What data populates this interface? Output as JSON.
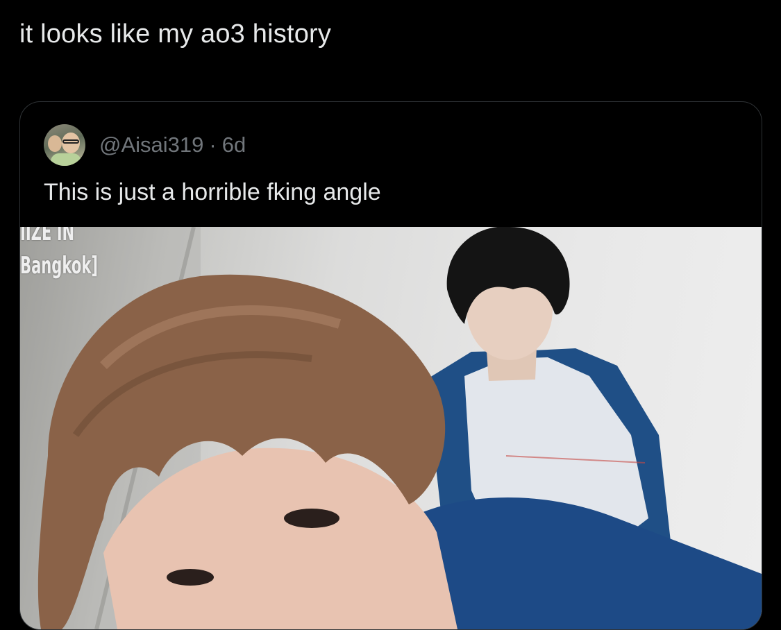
{
  "tweet": {
    "text": "it looks like my ao3 history"
  },
  "quoted_tweet": {
    "handle": "@Aisai319",
    "separator": "·",
    "time": "6d",
    "text": "This is just a horrible fking angle",
    "avatar_icon": "avatar-photo",
    "media": {
      "watermark_top": "IIZE IN",
      "watermark": "Bangkok]"
    }
  },
  "colors": {
    "background": "#000000",
    "text_primary": "#e7e9ea",
    "text_secondary": "#71767b",
    "border": "#2f3336"
  }
}
